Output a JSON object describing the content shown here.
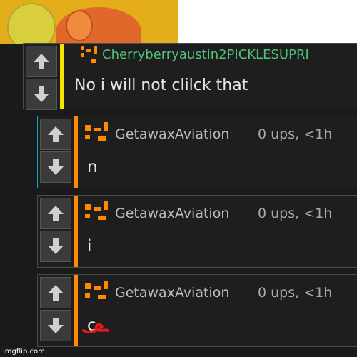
{
  "top_image": {
    "kind": "meme-reaction-image"
  },
  "comments": [
    {
      "username": "Cherryberryaustin2PICKLESUPRI",
      "meta": "",
      "body": "No i will not clilck that"
    },
    {
      "username": "GetawaxAviation",
      "meta": "0 ups, <1h",
      "body": "n"
    },
    {
      "username": "GetawaxAviation",
      "meta": "0 ups, <1h",
      "body": "i"
    },
    {
      "username": "GetawaxAviation",
      "meta": "0 ups, <1h",
      "body": "c"
    }
  ],
  "colors": {
    "accent_cyan": "#12a3c9",
    "username_green": "#4ec27a",
    "bar_yellow": "#f5e400",
    "bar_orange": "#ff8a00"
  },
  "watermark": "imgflip.com"
}
